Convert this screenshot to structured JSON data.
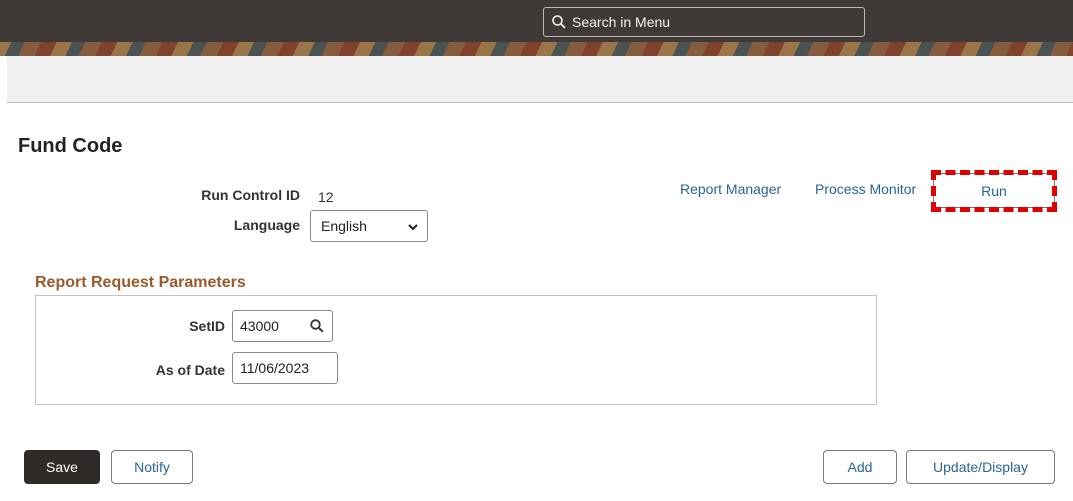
{
  "header": {
    "search_placeholder": "Search in Menu"
  },
  "page": {
    "title": "Fund Code"
  },
  "run_control": {
    "run_control_id_label": "Run Control ID",
    "run_control_id_value": "12",
    "language_label": "Language",
    "language_value": "English"
  },
  "actions": {
    "report_manager": "Report Manager",
    "process_monitor": "Process Monitor",
    "run": "Run"
  },
  "parameters": {
    "section_title": "Report Request Parameters",
    "setid_label": "SetID",
    "setid_value": "43000",
    "as_of_date_label": "As of Date",
    "as_of_date_value": "11/06/2023"
  },
  "footer": {
    "save": "Save",
    "notify": "Notify",
    "add": "Add",
    "update_display": "Update/Display"
  },
  "colors": {
    "link": "#2a6496",
    "section_title": "#9c5a2c",
    "highlight": "#e00000",
    "primary_button": "#2f2b28"
  }
}
